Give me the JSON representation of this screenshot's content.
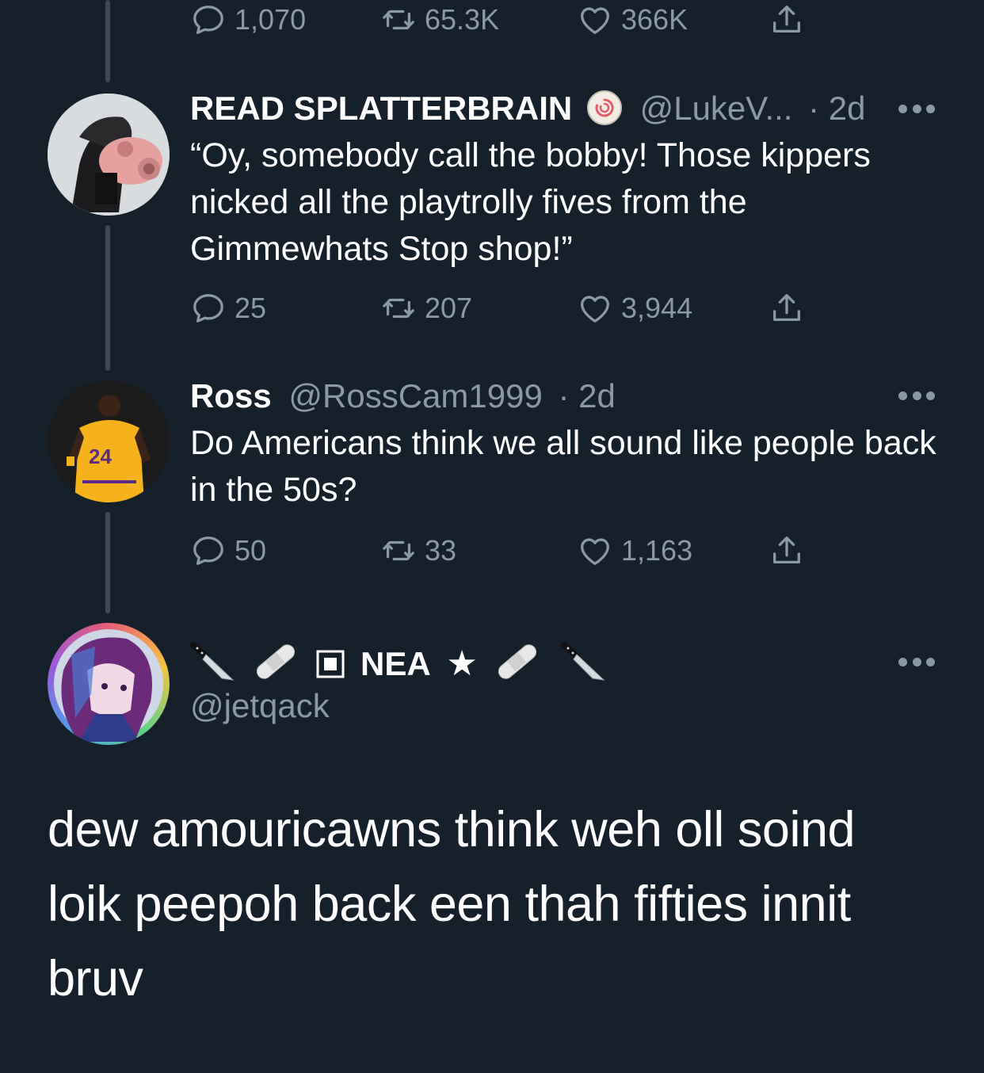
{
  "top_actions": {
    "replies": "1,070",
    "retweets": "65.3K",
    "likes": "366K"
  },
  "tweets": [
    {
      "display_name": "READ SPLATTERBRAIN",
      "handle": "@LukeV...",
      "time": "· 2d",
      "text": "“Oy, somebody call the bobby! Those kippers nicked all the playtrolly fives from the Gimmewhats Stop shop!”",
      "replies": "25",
      "retweets": "207",
      "likes": "3,944"
    },
    {
      "display_name": "Ross",
      "handle": "@RossCam1999",
      "time": "· 2d",
      "text": "Do Americans think we all sound like people back in the 50s?",
      "replies": "50",
      "retweets": "33",
      "likes": "1,163"
    }
  ],
  "quote": {
    "display_name": "NEA",
    "handle": "@jetqack",
    "text": "dew amouricawns think weh oll soind loik peepoh back een thah fifties innit bruv"
  },
  "colors": {
    "background": "#16202b",
    "secondary_text": "#8b98a5",
    "thread_line": "#3d4955"
  },
  "icons": [
    "reply-icon",
    "retweet-icon",
    "like-icon",
    "share-icon",
    "more-icon",
    "knife-icon",
    "bandage-icon",
    "stop-square-icon",
    "star-icon",
    "badge-icon"
  ]
}
